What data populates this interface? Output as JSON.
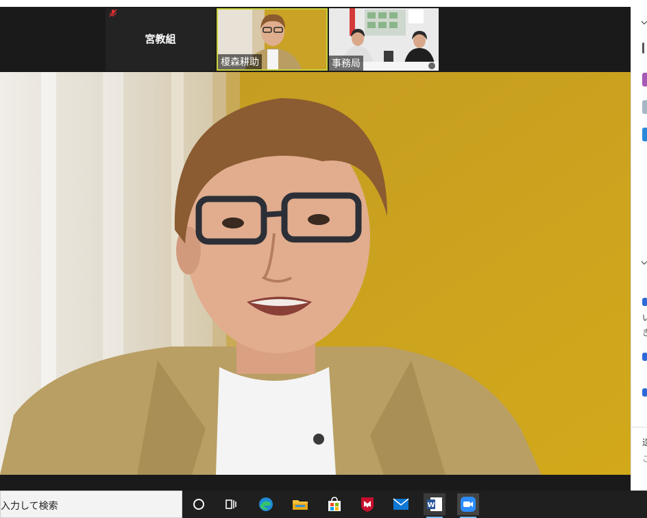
{
  "participants": {
    "name_only_tile": {
      "name": "宮教組",
      "muted": true
    },
    "video_tile_1": {
      "name": "榎森耕助",
      "active_speaker": true
    },
    "video_tile_2": {
      "name": "事務局"
    }
  },
  "side_panel": {
    "line_1": "い",
    "line_2": "き",
    "footer_1": "送",
    "footer_2": "こ"
  },
  "taskbar": {
    "search_placeholder": "入力して検索",
    "icons": [
      "cortana-icon",
      "task-view-icon",
      "edge-icon",
      "file-explorer-icon",
      "store-icon",
      "mcafee-icon",
      "mail-icon",
      "word-icon",
      "zoom-icon"
    ]
  },
  "colors": {
    "active_speaker_border": "#c9d23a",
    "zoom_blue": "#2d8cff",
    "wall_yellow": "#c9a21e"
  }
}
